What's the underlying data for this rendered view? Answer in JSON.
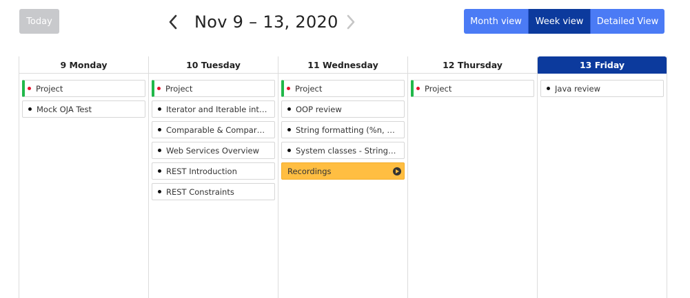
{
  "toolbar": {
    "today_label": "Today",
    "range_title": "Nov 9 – 13, 2020",
    "views": [
      {
        "label": "Month view",
        "active": false
      },
      {
        "label": "Week view",
        "active": true
      },
      {
        "label": "Detailed View",
        "active": false
      }
    ]
  },
  "colors": {
    "primary": "#4b7bf5",
    "active": "#0c3a9d",
    "project_bar": "#21b84a",
    "project_dot": "#e8112d",
    "recording": "#ffbe42",
    "today_button": "#c8c9cc"
  },
  "days": [
    {
      "label": "9 Monday",
      "events": [
        {
          "label": "Project",
          "type": "project"
        },
        {
          "label": "Mock OJA Test",
          "type": "normal"
        }
      ]
    },
    {
      "label": "10 Tuesday",
      "events": [
        {
          "label": "Project",
          "type": "project"
        },
        {
          "label": "Iterator and Iterable interfa...",
          "type": "normal"
        },
        {
          "label": "Comparable & Comparato...",
          "type": "normal"
        },
        {
          "label": "Web Services Overview",
          "type": "normal"
        },
        {
          "label": "REST Introduction",
          "type": "normal"
        },
        {
          "label": "REST Constraints",
          "type": "normal"
        }
      ]
    },
    {
      "label": "11 Wednesday",
      "events": [
        {
          "label": "Project",
          "type": "project"
        },
        {
          "label": "OOP review",
          "type": "normal"
        },
        {
          "label": "String formatting (%n, %d, ...",
          "type": "normal"
        },
        {
          "label": "System classes - String, Ra...",
          "type": "normal"
        },
        {
          "label": "Recordings",
          "type": "recording"
        }
      ]
    },
    {
      "label": "12 Thursday",
      "events": [
        {
          "label": "Project",
          "type": "project"
        }
      ]
    },
    {
      "label": "13 Friday",
      "today": true,
      "events": [
        {
          "label": "Java review",
          "type": "normal"
        }
      ]
    }
  ]
}
